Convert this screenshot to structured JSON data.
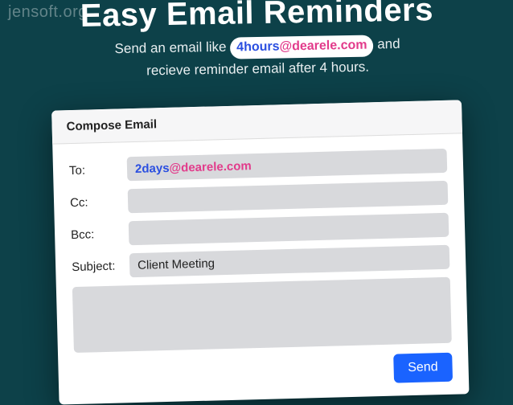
{
  "watermark": "jensoft.org",
  "hero": {
    "title": "Easy Email Reminders",
    "line1_pre": "Send an email like ",
    "pill_time": "4hours",
    "pill_domain": "@dearele.com",
    "line1_post": " and",
    "line2": "recieve reminder email after 4 hours."
  },
  "panel": {
    "header": "Compose Email",
    "labels": {
      "to": "To:",
      "cc": "Cc:",
      "bcc": "Bcc:",
      "subject": "Subject:"
    },
    "values": {
      "to_time": "2days",
      "to_domain": "@dearele.com",
      "cc": "",
      "bcc": "",
      "subject": "Client Meeting",
      "body": ""
    },
    "send": "Send"
  }
}
